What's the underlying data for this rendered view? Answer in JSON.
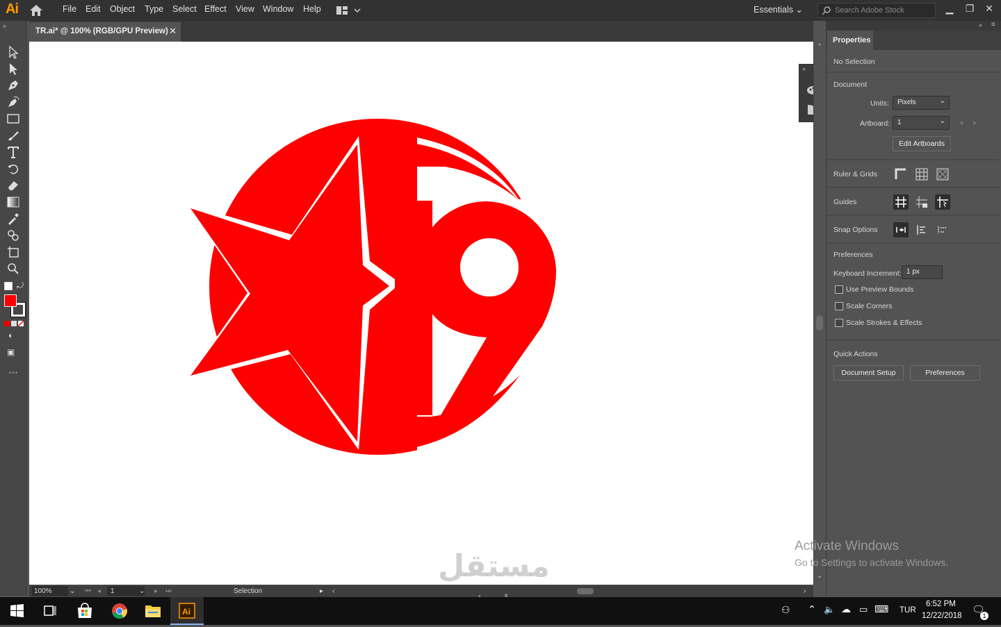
{
  "app": {
    "logo": "Ai",
    "accent_color": "#ff9a00"
  },
  "menu": [
    "File",
    "Edit",
    "Object",
    "Type",
    "Select",
    "Effect",
    "View",
    "Window",
    "Help"
  ],
  "workspace": {
    "name": "Essentials"
  },
  "search": {
    "placeholder": "Search Adobe Stock"
  },
  "document_tab": {
    "title": "TR.ai* @ 100% (RGB/GPU Preview)",
    "close": "✕"
  },
  "artwork": {
    "number": "19",
    "color": "#ff0000"
  },
  "toolbar": {
    "tools": [
      "selection-tool",
      "direct-selection-tool",
      "pen-tool",
      "curvature-tool",
      "rectangle-tool",
      "paintbrush-tool",
      "type-tool",
      "rotate-tool",
      "eraser-tool",
      "gradient-tool",
      "eyedropper-tool",
      "shape-builder-tool",
      "artboard-tool",
      "zoom-tool"
    ],
    "fill_color": "#ff0000",
    "stroke_color": "#ffffff"
  },
  "statusbar": {
    "zoom": "100%",
    "artboard": "1",
    "tool": "Selection"
  },
  "properties": {
    "tab": "Properties",
    "selection": "No Selection",
    "document_section": "Document",
    "units_label": "Units:",
    "units_value": "Pixels",
    "artboard_label": "Artboard:",
    "artboard_value": "1",
    "edit_artboards": "Edit Artboards",
    "rulers_grids": "Ruler & Grids",
    "guides": "Guides",
    "snap_options": "Snap Options",
    "preferences_section": "Preferences",
    "keyboard_increment_label": "Keyboard Increment:",
    "keyboard_increment_value": "1 px",
    "use_preview_bounds": "Use Preview Bounds",
    "scale_corners": "Scale Corners",
    "scale_strokes": "Scale Strokes & Effects",
    "quick_actions": "Quick Actions",
    "document_setup": "Document Setup",
    "preferences_btn": "Preferences"
  },
  "overlay": {
    "activate_title": "Activate Windows",
    "activate_sub": "Go to Settings to activate Windows.",
    "watermark_ar": "مستقل",
    "watermark_en": "mostaql.com"
  },
  "taskbar": {
    "language": "TUR",
    "time": "6:52 PM",
    "date": "12/22/2018",
    "notifications": "1"
  }
}
